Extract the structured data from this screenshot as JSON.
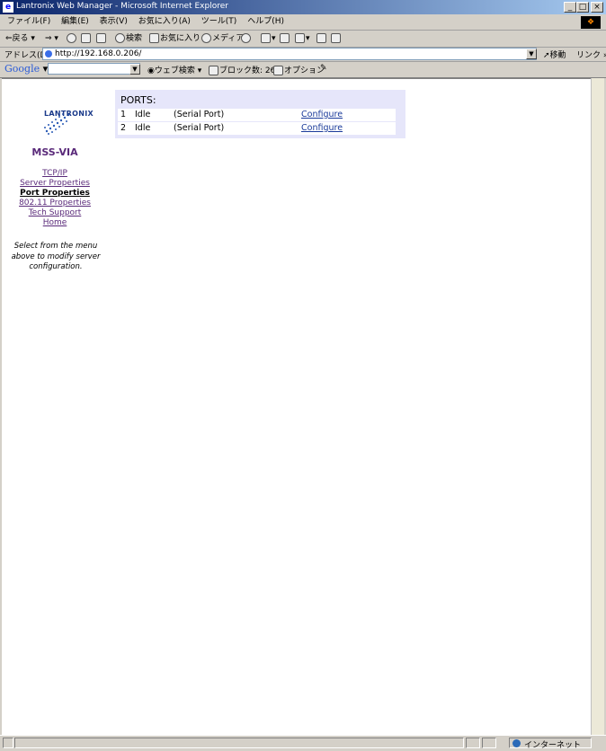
{
  "window": {
    "title": "Lantronix Web Manager - Microsoft Internet Explorer",
    "controls": [
      "_",
      "□",
      "×"
    ]
  },
  "menu": [
    "ファイル(F)",
    "編集(E)",
    "表示(V)",
    "お気に入り(A)",
    "ツール(T)",
    "ヘルプ(H)"
  ],
  "toolbar": {
    "back": "戻る",
    "search": "検索",
    "favorites": "お気に入り",
    "media": "メディア"
  },
  "address": {
    "label": "アドレス(D)",
    "url": "http://192.168.0.206/",
    "go": "移動",
    "links": "リンク »"
  },
  "google": {
    "logo": "Google",
    "web_search": "ウェブ検索",
    "popup_blocked": "ブロック数: 26",
    "options": "オプション"
  },
  "sidebar": {
    "brand": "LANTRONIX",
    "product": "MSS-VIA",
    "nav": [
      {
        "label": "TCP/IP",
        "active": false
      },
      {
        "label": "Server Properties",
        "active": false
      },
      {
        "label": "Port Properties",
        "active": true
      },
      {
        "label": "802.11 Properties",
        "active": false
      },
      {
        "label": "Tech Support",
        "active": false
      },
      {
        "label": "Home",
        "active": false
      }
    ],
    "help": "Select from the menu above to modify server configuration."
  },
  "ports": {
    "title": "PORTS:",
    "rows": [
      {
        "num": "1",
        "status": "Idle",
        "type": "(Serial Port)",
        "action": "Configure"
      },
      {
        "num": "2",
        "status": "Idle",
        "type": "(Serial Port)",
        "action": "Configure"
      }
    ]
  },
  "status": {
    "zone": "インターネット"
  },
  "colors": {
    "panel": "#e6e6fa",
    "link": "#5a2a7a",
    "titlebar": "#0a246a"
  }
}
